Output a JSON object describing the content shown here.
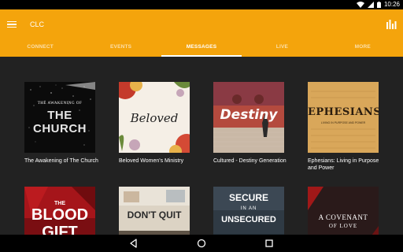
{
  "status_bar": {
    "time": "10:26",
    "icons": [
      "wifi-icon",
      "signal-icon",
      "battery-icon"
    ]
  },
  "app_bar": {
    "title": "CLC",
    "menu_icon": "hamburger-icon",
    "action_icon": "bar-chart-icon"
  },
  "tabs": [
    {
      "label": "CONNECT",
      "active": false
    },
    {
      "label": "EVENTS",
      "active": false
    },
    {
      "label": "MESSAGES",
      "active": true
    },
    {
      "label": "LIVE",
      "active": false
    },
    {
      "label": "MORE",
      "active": false
    }
  ],
  "messages": [
    {
      "title": "The Awakening of The Church",
      "art_top": "THE AWAKENING OF",
      "art_main": "THE CHURCH"
    },
    {
      "title": "Beloved Women's Ministry",
      "art_main": "Beloved"
    },
    {
      "title": "Cultured - Destiny Generation",
      "art_main": "Destiny"
    },
    {
      "title": "Ephesians: Living in Purpose and Power",
      "art_main": "EPHESIANS",
      "art_sub": "LIVING IN PURPOSE AND POWER"
    },
    {
      "title": "",
      "art_top": "THE",
      "art_main": "BLOOD",
      "art_sub": "GIFT"
    },
    {
      "title": "",
      "art_main": "DON'T QUIT"
    },
    {
      "title": "",
      "art_top": "SECURE",
      "art_mid": "IN AN",
      "art_main": "UNSECURED"
    },
    {
      "title": "",
      "art_top": "A COVENANT",
      "art_main": "OF LOVE"
    }
  ],
  "nav_bar": {
    "icons": [
      "back-icon",
      "home-icon",
      "recents-icon"
    ]
  },
  "colors": {
    "accent": "#f4a40c",
    "background": "#222222"
  }
}
